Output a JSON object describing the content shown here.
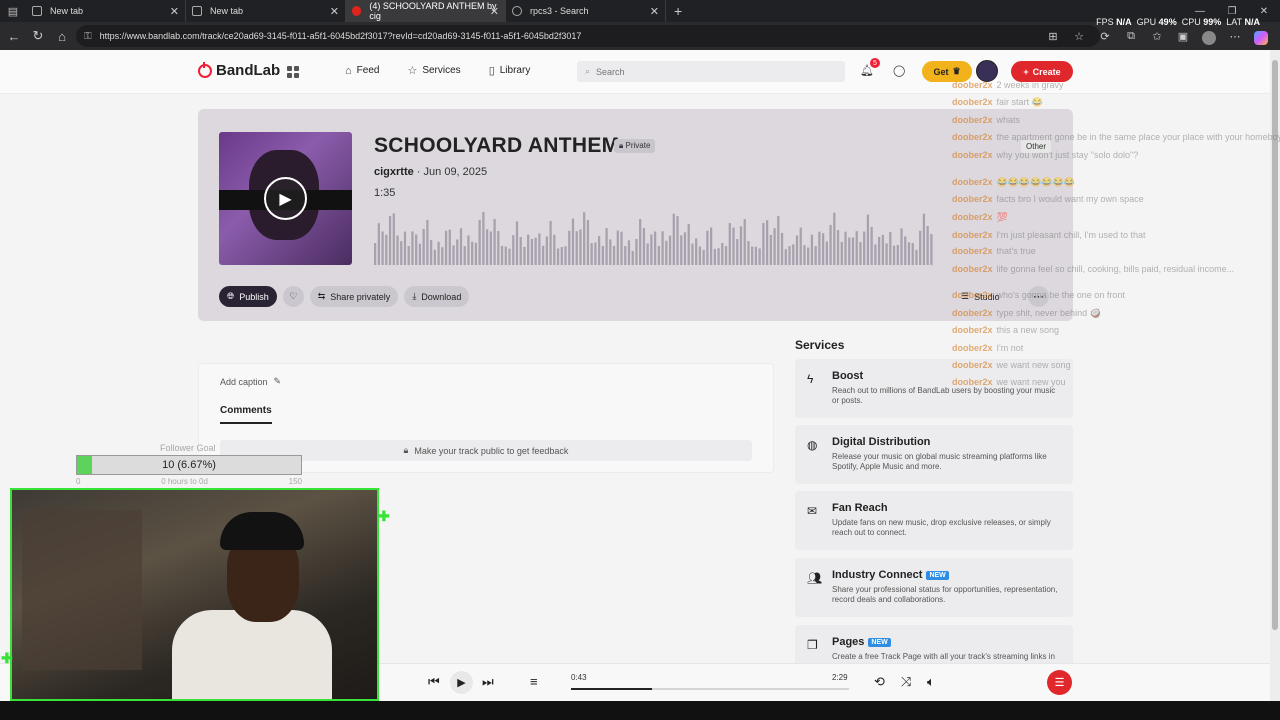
{
  "browser": {
    "tabs": [
      {
        "title": "New tab"
      },
      {
        "title": "New tab"
      },
      {
        "title": "(4) SCHOOLYARD ANTHEM by cig"
      },
      {
        "title": "rpcs3 - Search"
      }
    ],
    "url": "https://www.bandlab.com/track/ce20ad69-3145-f011-a5f1-6045bd2f3017?revId=cd20ad69-3145-f011-a5f1-6045bd2f3017",
    "perf": {
      "fps_label": "FPS",
      "fps": "N/A",
      "gpu_label": "GPU",
      "gpu": "49",
      "cpu_label": "CPU",
      "cpu": "99",
      "lat_label": "LAT",
      "lat": "N/A",
      "pct": "%"
    }
  },
  "header": {
    "logo": "BandLab",
    "nav": [
      {
        "label": "Feed",
        "icon": "home-icon"
      },
      {
        "label": "Services",
        "icon": "star-icon"
      },
      {
        "label": "Library",
        "icon": "library-icon"
      }
    ],
    "search_placeholder": "Search",
    "notif_count": "5",
    "get_label": "Get",
    "create_label": "Create"
  },
  "track": {
    "title": "SCHOOLYARD ANTHEM",
    "privacy": "Private",
    "artist": "cigxrtte",
    "date": "Jun 09, 2025",
    "duration": "1:35",
    "actions": {
      "publish": "Publish",
      "share": "Share privately",
      "download": "Download",
      "studio": "Studio"
    }
  },
  "comments": {
    "add_caption": "Add caption",
    "tab": "Comments",
    "feedback": "Make your track public to get feedback"
  },
  "services": {
    "heading": "Services",
    "items": [
      {
        "name": "Boost",
        "desc": "Reach out to millions of BandLab users by boosting your music or posts.",
        "icon": "bolt-icon",
        "badge": ""
      },
      {
        "name": "Digital Distribution",
        "desc": "Release your music on global music streaming platforms like Spotify, Apple Music and more.",
        "icon": "globe-icon",
        "badge": ""
      },
      {
        "name": "Fan Reach",
        "desc": "Update fans on new music, drop exclusive releases, or simply reach out to connect.",
        "icon": "mail-icon",
        "badge": ""
      },
      {
        "name": "Industry Connect",
        "desc": "Share your professional status for opportunities, representation, record deals and collaborations.",
        "icon": "people-icon",
        "badge": "NEW"
      },
      {
        "name": "Pages",
        "desc": "Create a free Track Page with all your track's streaming links in",
        "icon": "pages-icon",
        "badge": "NEW"
      }
    ]
  },
  "overlay": {
    "chat_tag": "Other",
    "chat": [
      {
        "user": "doober2x",
        "msg": "2 weeks in gravy"
      },
      {
        "user": "doober2x",
        "msg": "fair start 😂"
      },
      {
        "user": "doober2x",
        "msg": "whats"
      },
      {
        "user": "doober2x",
        "msg": "the apartment gone be in the same place your place with your homeboys gone be?"
      },
      {
        "user": "doober2x",
        "msg": "why you won't just stay \"solo dolo\"?"
      },
      {
        "user": "doober2x",
        "msg": "😂😂😂😂😂😂😂"
      },
      {
        "user": "doober2x",
        "msg": "facts bro I would want my own space"
      },
      {
        "user": "doober2x",
        "msg": "💯"
      },
      {
        "user": "doober2x",
        "msg": "I'm just pleasant chill, I'm used to that"
      },
      {
        "user": "doober2x",
        "msg": "that's true"
      },
      {
        "user": "doober2x",
        "msg": "life gonna feel so chill, cooking, bills paid, residual income..."
      },
      {
        "user": "doober2x",
        "msg": "who's gonna be the one on front"
      },
      {
        "user": "doober2x",
        "msg": "type shit, never behind 🥥"
      },
      {
        "user": "doober2x",
        "msg": "this a new song"
      },
      {
        "user": "doober2x",
        "msg": "I'm not"
      },
      {
        "user": "doober2x",
        "msg": "we want new song"
      },
      {
        "user": "doober2x",
        "msg": "we want new you"
      }
    ],
    "goal_label": "Follower Goal",
    "goal_value": 0.0667,
    "goal_text": "10 (6.67%)",
    "goal_min": "0",
    "goal_mid": "0 hours to 0d",
    "goal_max": "150"
  },
  "player": {
    "current": "0:43",
    "total": "2:29",
    "progress": 0.29
  }
}
